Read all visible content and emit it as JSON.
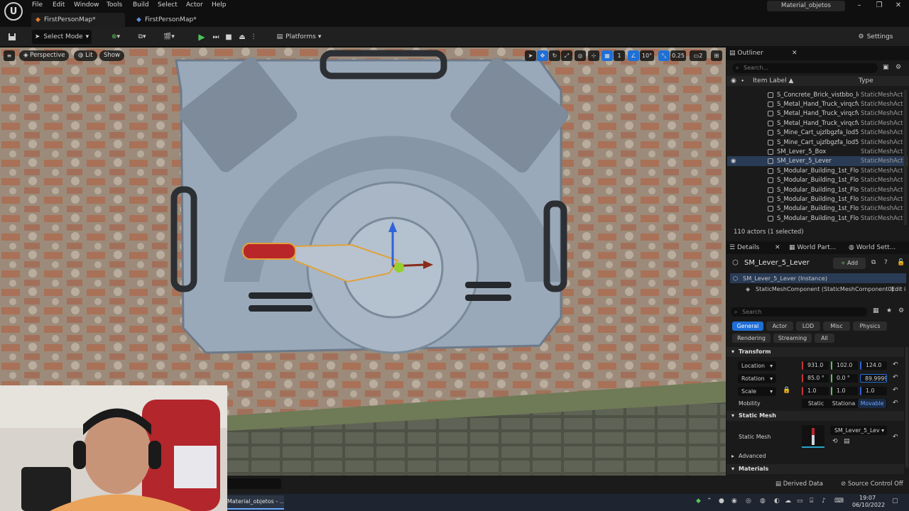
{
  "menubar": {
    "items": [
      "File",
      "Edit",
      "Window",
      "Tools",
      "Build",
      "Select",
      "Actor",
      "Help"
    ],
    "project": "Material_objetos"
  },
  "tabs": [
    "FirstPersonMap*",
    "FirstPersonMap*"
  ],
  "toolbar": {
    "select_mode": "Select Mode",
    "platforms": "Platforms",
    "settings": "Settings"
  },
  "viewport": {
    "perspective": "Perspective",
    "lit": "Lit",
    "show": "Show",
    "grid_value": "1",
    "rotation_snap": "10°",
    "scale_snap": "0.25",
    "camera_speed": "2"
  },
  "outliner": {
    "title": "Outliner",
    "search_placeholder": "Search...",
    "col_label": "Item Label ▲",
    "col_type": "Type",
    "rows": [
      {
        "name": "S_Concrete_Brick_vistbbo_lo",
        "type": "StaticMeshAct"
      },
      {
        "name": "S_Metal_Hand_Truck_virqcfw",
        "type": "StaticMeshAct"
      },
      {
        "name": "S_Metal_Hand_Truck_virqcfw",
        "type": "StaticMeshAct"
      },
      {
        "name": "S_Metal_Hand_Truck_virqcfw",
        "type": "StaticMeshAct"
      },
      {
        "name": "S_Mine_Cart_ujzlbgzfa_lod5_",
        "type": "StaticMeshAct"
      },
      {
        "name": "S_Mine_Cart_ujzlbgzfa_lod5_",
        "type": "StaticMeshAct"
      },
      {
        "name": "SM_Lever_5_Box",
        "type": "StaticMeshAct"
      },
      {
        "name": "SM_Lever_5_Lever",
        "type": "StaticMeshAct"
      },
      {
        "name": "S_Modular_Building_1st_Floor",
        "type": "StaticMeshAct"
      },
      {
        "name": "S_Modular_Building_1st_Floor",
        "type": "StaticMeshAct"
      },
      {
        "name": "S_Modular_Building_1st_Floor",
        "type": "StaticMeshAct"
      },
      {
        "name": "S_Modular_Building_1st_Floor",
        "type": "StaticMeshAct"
      },
      {
        "name": "S_Modular_Building_1st_Floor",
        "type": "StaticMeshAct"
      },
      {
        "name": "S_Modular_Building_1st_Floor",
        "type": "StaticMeshAct"
      }
    ],
    "status": "110 actors (1 selected)"
  },
  "details": {
    "tab_details": "Details",
    "tab_world_part": "World Part...",
    "tab_world_settings": "World Sett...",
    "object_name": "SM_Lever_5_Lever",
    "add_label": "Add",
    "instance": "SM_Lever_5_Lever (Instance)",
    "component": "StaticMeshComponent (StaticMeshComponent0)",
    "edit_link": "Edit i",
    "search_placeholder": "Search",
    "categories": [
      "General",
      "Actor",
      "LOD",
      "Misc",
      "Physics",
      "Rendering",
      "Streaming",
      "All"
    ],
    "transform_header": "Transform",
    "location_label": "Location",
    "location": [
      "931.0",
      "102.0",
      "124.0"
    ],
    "rotation_label": "Rotation",
    "rotation": [
      "85.0 °",
      "0.0 °",
      "89.9999"
    ],
    "scale_label": "Scale",
    "scale": [
      "1.0",
      "1.0",
      "1.0"
    ],
    "mobility_label": "Mobility",
    "mobility_options": [
      "Static",
      "Stationa",
      "Movable"
    ],
    "static_mesh_header": "Static Mesh",
    "static_mesh_label": "Static Mesh",
    "static_mesh_value": "SM_Lever_5_Lev",
    "advanced_header": "Advanced",
    "materials_header": "Materials"
  },
  "bottombar": {
    "derived_data": "Derived Data",
    "source_control": "Source Control Off"
  },
  "taskbar": {
    "app_label": "Material_objetos - ...",
    "time": "19:07",
    "date": "06/10/2022"
  },
  "colors": {
    "accent_blue": "#1f6fd6",
    "play_green": "#4cc35a",
    "selection_row": "#2a3b55"
  }
}
